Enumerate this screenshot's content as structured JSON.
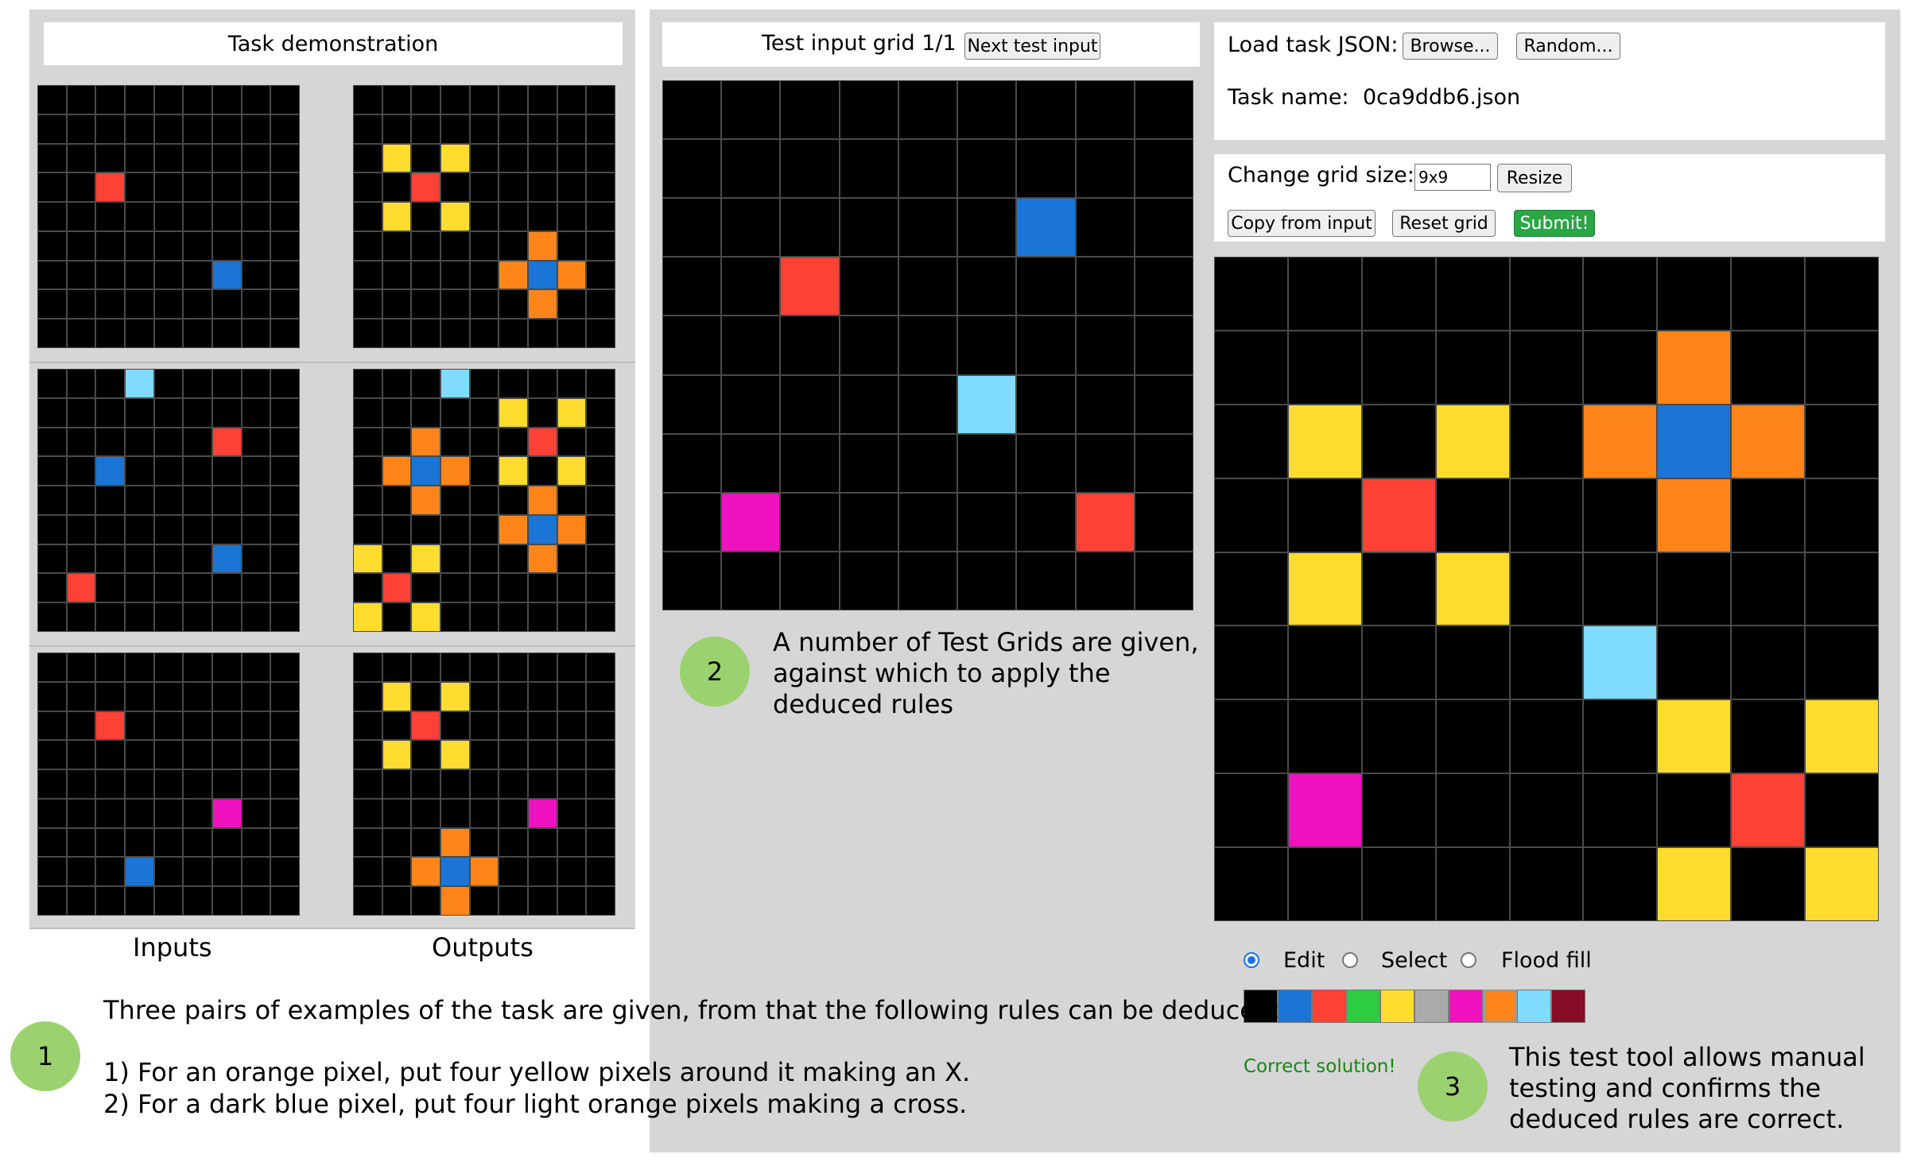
{
  "colors": {
    "palette": [
      "#000000",
      "#1a75d6",
      "#ff4136",
      "#2ecc40",
      "#ffdc2f",
      "#aaaaaa",
      "#f012be",
      "#ff851b",
      "#7fdbff",
      "#870c25"
    ],
    "correct_text": "#138a13",
    "circle": "#9bd16f"
  },
  "demo": {
    "title": "Task demonstration",
    "inputs_label": "Inputs",
    "outputs_label": "Outputs",
    "pairs": [
      {
        "input": [
          [
            0,
            0,
            0,
            0,
            0,
            0,
            0,
            0,
            0
          ],
          [
            0,
            0,
            0,
            0,
            0,
            0,
            0,
            0,
            0
          ],
          [
            0,
            0,
            0,
            0,
            0,
            0,
            0,
            0,
            0
          ],
          [
            0,
            0,
            2,
            0,
            0,
            0,
            0,
            0,
            0
          ],
          [
            0,
            0,
            0,
            0,
            0,
            0,
            0,
            0,
            0
          ],
          [
            0,
            0,
            0,
            0,
            0,
            0,
            0,
            0,
            0
          ],
          [
            0,
            0,
            0,
            0,
            0,
            0,
            1,
            0,
            0
          ],
          [
            0,
            0,
            0,
            0,
            0,
            0,
            0,
            0,
            0
          ],
          [
            0,
            0,
            0,
            0,
            0,
            0,
            0,
            0,
            0
          ]
        ],
        "output": [
          [
            0,
            0,
            0,
            0,
            0,
            0,
            0,
            0,
            0
          ],
          [
            0,
            0,
            0,
            0,
            0,
            0,
            0,
            0,
            0
          ],
          [
            0,
            4,
            0,
            4,
            0,
            0,
            0,
            0,
            0
          ],
          [
            0,
            0,
            2,
            0,
            0,
            0,
            0,
            0,
            0
          ],
          [
            0,
            4,
            0,
            4,
            0,
            0,
            0,
            0,
            0
          ],
          [
            0,
            0,
            0,
            0,
            0,
            0,
            7,
            0,
            0
          ],
          [
            0,
            0,
            0,
            0,
            0,
            7,
            1,
            7,
            0
          ],
          [
            0,
            0,
            0,
            0,
            0,
            0,
            7,
            0,
            0
          ],
          [
            0,
            0,
            0,
            0,
            0,
            0,
            0,
            0,
            0
          ]
        ]
      },
      {
        "input": [
          [
            0,
            0,
            0,
            8,
            0,
            0,
            0,
            0,
            0
          ],
          [
            0,
            0,
            0,
            0,
            0,
            0,
            0,
            0,
            0
          ],
          [
            0,
            0,
            0,
            0,
            0,
            0,
            2,
            0,
            0
          ],
          [
            0,
            0,
            1,
            0,
            0,
            0,
            0,
            0,
            0
          ],
          [
            0,
            0,
            0,
            0,
            0,
            0,
            0,
            0,
            0
          ],
          [
            0,
            0,
            0,
            0,
            0,
            0,
            0,
            0,
            0
          ],
          [
            0,
            0,
            0,
            0,
            0,
            0,
            1,
            0,
            0
          ],
          [
            0,
            2,
            0,
            0,
            0,
            0,
            0,
            0,
            0
          ],
          [
            0,
            0,
            0,
            0,
            0,
            0,
            0,
            0,
            0
          ]
        ],
        "output": [
          [
            0,
            0,
            0,
            8,
            0,
            0,
            0,
            0,
            0
          ],
          [
            0,
            0,
            0,
            0,
            0,
            4,
            0,
            4,
            0
          ],
          [
            0,
            0,
            7,
            0,
            0,
            0,
            2,
            0,
            0
          ],
          [
            0,
            7,
            1,
            7,
            0,
            4,
            0,
            4,
            0
          ],
          [
            0,
            0,
            7,
            0,
            0,
            0,
            7,
            0,
            0
          ],
          [
            0,
            0,
            0,
            0,
            0,
            7,
            1,
            7,
            0
          ],
          [
            4,
            0,
            4,
            0,
            0,
            0,
            7,
            0,
            0
          ],
          [
            0,
            2,
            0,
            0,
            0,
            0,
            0,
            0,
            0
          ],
          [
            4,
            0,
            4,
            0,
            0,
            0,
            0,
            0,
            0
          ]
        ]
      },
      {
        "input": [
          [
            0,
            0,
            0,
            0,
            0,
            0,
            0,
            0,
            0
          ],
          [
            0,
            0,
            0,
            0,
            0,
            0,
            0,
            0,
            0
          ],
          [
            0,
            0,
            2,
            0,
            0,
            0,
            0,
            0,
            0
          ],
          [
            0,
            0,
            0,
            0,
            0,
            0,
            0,
            0,
            0
          ],
          [
            0,
            0,
            0,
            0,
            0,
            0,
            0,
            0,
            0
          ],
          [
            0,
            0,
            0,
            0,
            0,
            0,
            6,
            0,
            0
          ],
          [
            0,
            0,
            0,
            0,
            0,
            0,
            0,
            0,
            0
          ],
          [
            0,
            0,
            0,
            1,
            0,
            0,
            0,
            0,
            0
          ],
          [
            0,
            0,
            0,
            0,
            0,
            0,
            0,
            0,
            0
          ]
        ],
        "output": [
          [
            0,
            0,
            0,
            0,
            0,
            0,
            0,
            0,
            0
          ],
          [
            0,
            4,
            0,
            4,
            0,
            0,
            0,
            0,
            0
          ],
          [
            0,
            0,
            2,
            0,
            0,
            0,
            0,
            0,
            0
          ],
          [
            0,
            4,
            0,
            4,
            0,
            0,
            0,
            0,
            0
          ],
          [
            0,
            0,
            0,
            0,
            0,
            0,
            0,
            0,
            0
          ],
          [
            0,
            0,
            0,
            0,
            0,
            0,
            6,
            0,
            0
          ],
          [
            0,
            0,
            0,
            7,
            0,
            0,
            0,
            0,
            0
          ],
          [
            0,
            0,
            7,
            1,
            7,
            0,
            0,
            0,
            0
          ],
          [
            0,
            0,
            0,
            7,
            0,
            0,
            0,
            0,
            0
          ]
        ]
      }
    ]
  },
  "test": {
    "title": "Test input grid 1/1",
    "next_button": "Next test input",
    "input_grid": [
      [
        0,
        0,
        0,
        0,
        0,
        0,
        0,
        0,
        0
      ],
      [
        0,
        0,
        0,
        0,
        0,
        0,
        0,
        0,
        0
      ],
      [
        0,
        0,
        0,
        0,
        0,
        0,
        1,
        0,
        0
      ],
      [
        0,
        0,
        2,
        0,
        0,
        0,
        0,
        0,
        0
      ],
      [
        0,
        0,
        0,
        0,
        0,
        0,
        0,
        0,
        0
      ],
      [
        0,
        0,
        0,
        0,
        0,
        8,
        0,
        0,
        0
      ],
      [
        0,
        0,
        0,
        0,
        0,
        0,
        0,
        0,
        0
      ],
      [
        0,
        6,
        0,
        0,
        0,
        0,
        0,
        2,
        0
      ],
      [
        0,
        0,
        0,
        0,
        0,
        0,
        0,
        0,
        0
      ]
    ]
  },
  "controls": {
    "load_label": "Load task JSON:",
    "browse_button": "Browse...",
    "random_button": "Random...",
    "task_name_label": "Task name:",
    "task_name_value": "0ca9ddb6.json",
    "grid_size_label": "Change grid size:",
    "grid_size_value": "9x9",
    "resize_button": "Resize",
    "copy_button": "Copy from input",
    "reset_button": "Reset grid",
    "submit_button": "Submit!",
    "mode_edit": "Edit",
    "mode_select": "Select",
    "mode_flood": "Flood fill",
    "selected_mode": "Edit",
    "selected_color_index": 7,
    "status_text": "Correct solution!"
  },
  "output_grid": [
    [
      0,
      0,
      0,
      0,
      0,
      0,
      0,
      0,
      0
    ],
    [
      0,
      0,
      0,
      0,
      0,
      0,
      7,
      0,
      0
    ],
    [
      0,
      4,
      0,
      4,
      0,
      7,
      1,
      7,
      0
    ],
    [
      0,
      0,
      2,
      0,
      0,
      0,
      7,
      0,
      0
    ],
    [
      0,
      4,
      0,
      4,
      0,
      0,
      0,
      0,
      0
    ],
    [
      0,
      0,
      0,
      0,
      0,
      8,
      0,
      0,
      0
    ],
    [
      0,
      0,
      0,
      0,
      0,
      0,
      4,
      0,
      4
    ],
    [
      0,
      6,
      0,
      0,
      0,
      0,
      0,
      2,
      0
    ],
    [
      0,
      0,
      0,
      0,
      0,
      0,
      4,
      0,
      4
    ]
  ],
  "annotations": {
    "step1": {
      "number": "1",
      "intro": "Three pairs of examples of the task are given, from that the following rules can be deduced:",
      "rule1": "1) For an orange pixel, put four yellow pixels around it making an X.",
      "rule2": "2) For a dark blue pixel, put four light orange pixels making a cross."
    },
    "step2": {
      "number": "2",
      "line1": "A number of Test Grids are given,",
      "line2": "against which to apply the",
      "line3": "deduced rules"
    },
    "step3": {
      "number": "3",
      "line1": "This test tool allows manual",
      "line2": "testing and confirms the",
      "line3": "deduced rules are correct."
    }
  }
}
